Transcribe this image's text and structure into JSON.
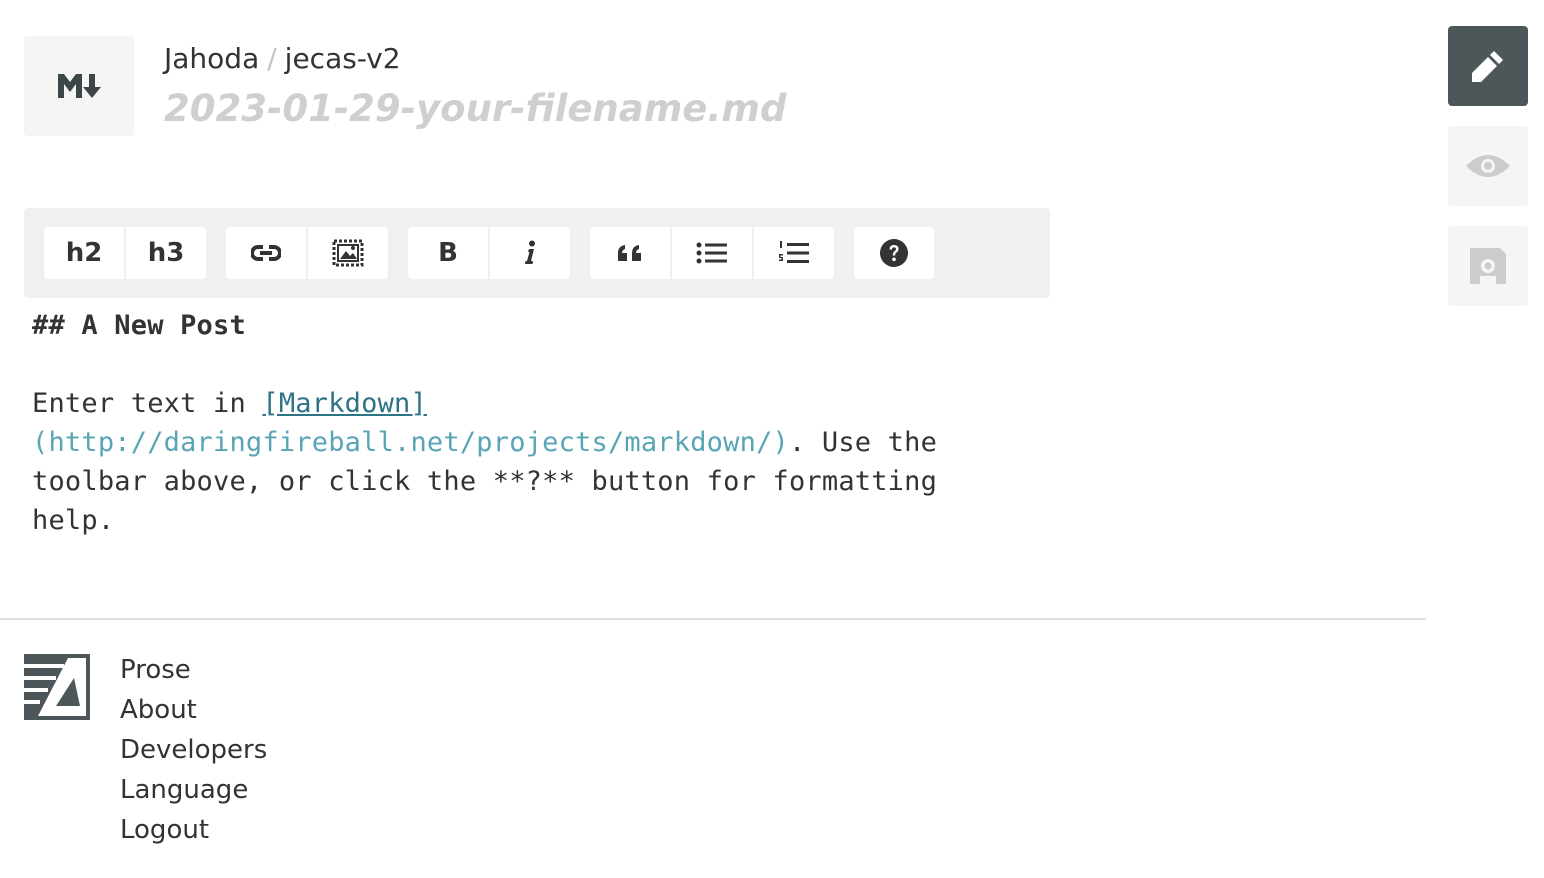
{
  "header": {
    "badge_icon": "markdown-icon",
    "breadcrumb": {
      "user": "Jahoda",
      "separator": "/",
      "repo": "jecas-v2"
    },
    "filename_placeholder": "2023-01-29-your-filename.md"
  },
  "toolbar": {
    "groups": [
      {
        "buttons": [
          {
            "label": "h2"
          },
          {
            "label": "h3"
          }
        ]
      },
      {
        "buttons": [
          {
            "icon": "link-icon"
          },
          {
            "icon": "image-icon"
          }
        ]
      },
      {
        "buttons": [
          {
            "label": "B"
          },
          {
            "icon": "italic-icon"
          }
        ]
      },
      {
        "buttons": [
          {
            "icon": "quote-icon"
          },
          {
            "icon": "bullet-list-icon"
          },
          {
            "icon": "numbered-list-icon"
          }
        ]
      },
      {
        "buttons": [
          {
            "icon": "help-icon"
          }
        ]
      }
    ]
  },
  "editor": {
    "heading": "## A New Post",
    "line1_prefix": "Enter text in ",
    "link_text": "[Markdown]",
    "link_url": "(http://daringfireball.net/projects/markdown/)",
    "line_rest": ". Use the toolbar above, or click the **?** button for formatting help."
  },
  "footer": {
    "logo_icon": "prose-logo-icon",
    "links": [
      "Prose",
      "About",
      "Developers",
      "Language",
      "Logout"
    ]
  },
  "side_buttons": [
    {
      "icon": "pencil-icon",
      "state": "active"
    },
    {
      "icon": "eye-icon",
      "state": "inactive"
    },
    {
      "icon": "save-icon",
      "state": "inactive"
    }
  ],
  "colors": {
    "active_button": "#4d5759",
    "inactive_icon": "#cccccc",
    "link": "#2d7487",
    "link_url": "#5aa5b5"
  }
}
